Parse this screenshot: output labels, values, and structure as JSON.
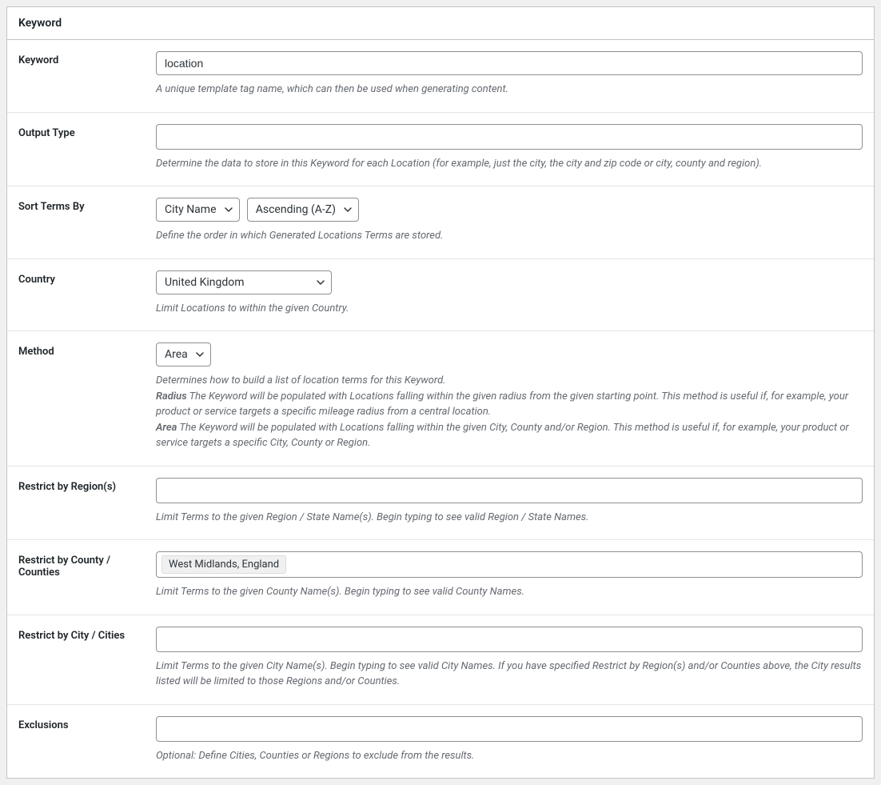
{
  "panel": {
    "title": "Keyword"
  },
  "keyword": {
    "label": "Keyword",
    "value": "location",
    "description": "A unique template tag name, which can then be used when generating content."
  },
  "outputType": {
    "label": "Output Type",
    "value": "",
    "description": "Determine the data to store in this Keyword for each Location (for example, just the city, the city and zip code or city, county and region)."
  },
  "sortTerms": {
    "label": "Sort Terms By",
    "field": "City Name",
    "direction": "Ascending (A-Z)",
    "description": "Define the order in which Generated Locations Terms are stored."
  },
  "country": {
    "label": "Country",
    "value": "United Kingdom",
    "description": "Limit Locations to within the given Country."
  },
  "method": {
    "label": "Method",
    "value": "Area",
    "description": "Determines how to build a list of location terms for this Keyword.",
    "radiusTerm": "Radius",
    "radiusText": " The Keyword will be populated with Locations falling within the given radius from the given starting point. This method is useful if, for example, your product or service targets a specific mileage radius from a central location.",
    "areaTerm": "Area",
    "areaText": " The Keyword will be populated with Locations falling within the given City, County and/or Region. This method is useful if, for example, your product or service targets a specific City, County or Region."
  },
  "restrictRegion": {
    "label": "Restrict by Region(s)",
    "description": "Limit Terms to the given Region / State Name(s). Begin typing to see valid Region / State Names."
  },
  "restrictCounty": {
    "label": "Restrict by County / Counties",
    "tag": "West Midlands, England",
    "description": "Limit Terms to the given County Name(s). Begin typing to see valid County Names."
  },
  "restrictCity": {
    "label": "Restrict by City / Cities",
    "description": "Limit Terms to the given City Name(s). Begin typing to see valid City Names. If you have specified Restrict by Region(s) and/or Counties above, the City results listed will be limited to those Regions and/or Counties."
  },
  "exclusions": {
    "label": "Exclusions",
    "description": "Optional: Define Cities, Counties or Regions to exclude from the results."
  }
}
